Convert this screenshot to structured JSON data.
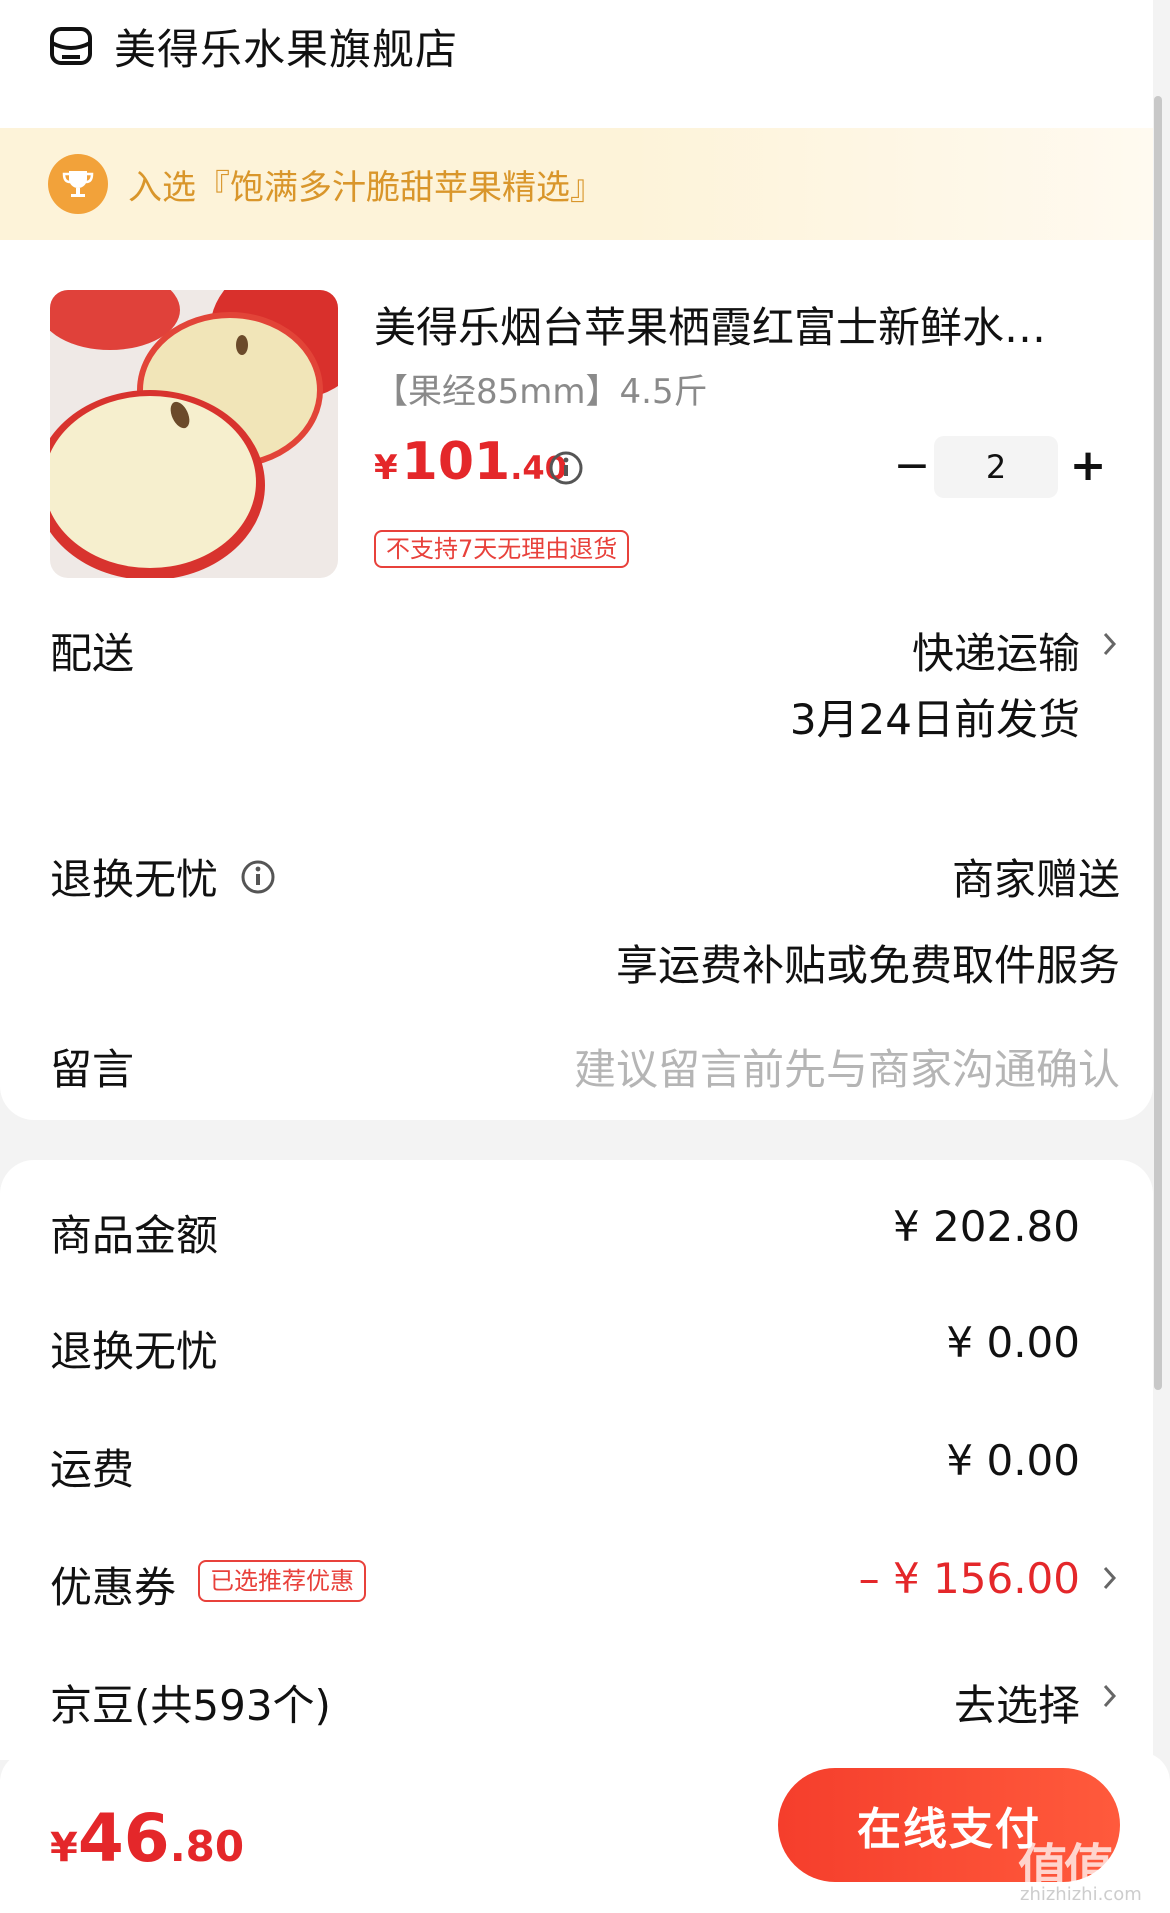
{
  "shop": {
    "name": "美得乐水果旗舰店",
    "icon": "store-icon"
  },
  "banner": {
    "text": "入选『饱满多汁脆甜苹果精选』",
    "icon": "trophy-icon"
  },
  "product": {
    "title": "美得乐烟台苹果栖霞红富士新鲜水…",
    "spec": "【果经85mm】4.5斤",
    "price_symbol": "¥",
    "price_int": "101",
    "price_dec": ".40",
    "no_return_tag": "不支持7天无理由退货",
    "quantity": "2",
    "minus": "−",
    "plus": "+"
  },
  "delivery": {
    "label": "配送",
    "method": "快递运输",
    "date": "3月24日前发货"
  },
  "return_service": {
    "label": "退换无忧",
    "value": "商家赠送",
    "desc": "享运费补贴或免费取件服务"
  },
  "message": {
    "label": "留言",
    "placeholder": "建议留言前先与商家沟通确认"
  },
  "summary": {
    "goods_label": "商品金额",
    "goods_value": "¥ 202.80",
    "return_label": "退换无忧",
    "return_value": "¥ 0.00",
    "shipping_label": "运费",
    "shipping_value": "¥ 0.00",
    "coupon_label": "优惠券",
    "coupon_tag": "已选推荐优惠",
    "coupon_value": "– ¥ 156.00",
    "beans_label": "京豆(共593个)",
    "beans_value": "去选择"
  },
  "footer": {
    "total_symbol": "¥",
    "total_int": "46",
    "total_dec": ".80",
    "pay_label": "在线支付"
  },
  "watermark": {
    "text": "值值值",
    "url": "zhizhizhi.com"
  },
  "colors": {
    "accent": "#e4272a",
    "banner_bg": "#fdf3d9",
    "banner_text": "#d9962b",
    "pay_button": "#f53e2c"
  }
}
